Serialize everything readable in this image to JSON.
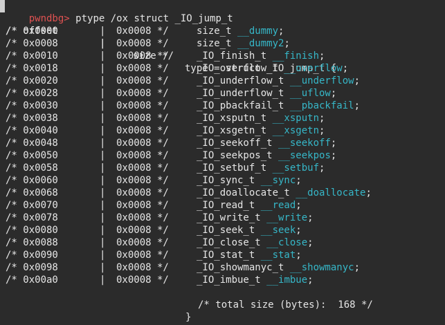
{
  "terminal": {
    "prompt": "pwndbg>",
    "command": " ptype /ox struct _IO_jump_t",
    "header": {
      "offset": "/* offset",
      "sep": "|",
      "size": "size */",
      "type_decl": "type = struct _IO_jump_t {"
    },
    "rows": [
      {
        "offset": "/* 0x0000",
        "sep": "|",
        "size": "0x0008 */",
        "type": "size_t ",
        "member": "__dummy",
        "end": ";"
      },
      {
        "offset": "/* 0x0008",
        "sep": "|",
        "size": "0x0008 */",
        "type": "size_t ",
        "member": "__dummy2",
        "end": ";"
      },
      {
        "offset": "/* 0x0010",
        "sep": "|",
        "size": "0x0008 */",
        "type": "_IO_finish_t ",
        "member": "__finish",
        "end": ";"
      },
      {
        "offset": "/* 0x0018",
        "sep": "|",
        "size": "0x0008 */",
        "type": "_IO_overflow_t ",
        "member": "__overflow",
        "end": ";"
      },
      {
        "offset": "/* 0x0020",
        "sep": "|",
        "size": "0x0008 */",
        "type": "_IO_underflow_t ",
        "member": "__underflow",
        "end": ";"
      },
      {
        "offset": "/* 0x0028",
        "sep": "|",
        "size": "0x0008 */",
        "type": "_IO_underflow_t ",
        "member": "__uflow",
        "end": ";"
      },
      {
        "offset": "/* 0x0030",
        "sep": "|",
        "size": "0x0008 */",
        "type": "_IO_pbackfail_t ",
        "member": "__pbackfail",
        "end": ";"
      },
      {
        "offset": "/* 0x0038",
        "sep": "|",
        "size": "0x0008 */",
        "type": "_IO_xsputn_t ",
        "member": "__xsputn",
        "end": ";"
      },
      {
        "offset": "/* 0x0040",
        "sep": "|",
        "size": "0x0008 */",
        "type": "_IO_xsgetn_t ",
        "member": "__xsgetn",
        "end": ";"
      },
      {
        "offset": "/* 0x0048",
        "sep": "|",
        "size": "0x0008 */",
        "type": "_IO_seekoff_t ",
        "member": "__seekoff",
        "end": ";"
      },
      {
        "offset": "/* 0x0050",
        "sep": "|",
        "size": "0x0008 */",
        "type": "_IO_seekpos_t ",
        "member": "__seekpos",
        "end": ";"
      },
      {
        "offset": "/* 0x0058",
        "sep": "|",
        "size": "0x0008 */",
        "type": "_IO_setbuf_t ",
        "member": "__setbuf",
        "end": ";"
      },
      {
        "offset": "/* 0x0060",
        "sep": "|",
        "size": "0x0008 */",
        "type": "_IO_sync_t ",
        "member": "__sync",
        "end": ";"
      },
      {
        "offset": "/* 0x0068",
        "sep": "|",
        "size": "0x0008 */",
        "type": "_IO_doallocate_t ",
        "member": "__doallocate",
        "end": ";"
      },
      {
        "offset": "/* 0x0070",
        "sep": "|",
        "size": "0x0008 */",
        "type": "_IO_read_t ",
        "member": "__read",
        "end": ";"
      },
      {
        "offset": "/* 0x0078",
        "sep": "|",
        "size": "0x0008 */",
        "type": "_IO_write_t ",
        "member": "__write",
        "end": ";"
      },
      {
        "offset": "/* 0x0080",
        "sep": "|",
        "size": "0x0008 */",
        "type": "_IO_seek_t ",
        "member": "__seek",
        "end": ";"
      },
      {
        "offset": "/* 0x0088",
        "sep": "|",
        "size": "0x0008 */",
        "type": "_IO_close_t ",
        "member": "__close",
        "end": ";"
      },
      {
        "offset": "/* 0x0090",
        "sep": "|",
        "size": "0x0008 */",
        "type": "_IO_stat_t ",
        "member": "__stat",
        "end": ";"
      },
      {
        "offset": "/* 0x0098",
        "sep": "|",
        "size": "0x0008 */",
        "type": "_IO_showmanyc_t ",
        "member": "__showmanyc",
        "end": ";"
      },
      {
        "offset": "/* 0x00a0",
        "sep": "|",
        "size": "0x0008 */",
        "type": "_IO_imbue_t ",
        "member": "__imbue",
        "end": ";"
      }
    ],
    "total": "/* total size (bytes):  168 */",
    "closing": "}",
    "colors": {
      "background": "#2b2b2b",
      "text": "#e6e6e6",
      "prompt": "#e05252",
      "member": "#36b7c8"
    }
  }
}
